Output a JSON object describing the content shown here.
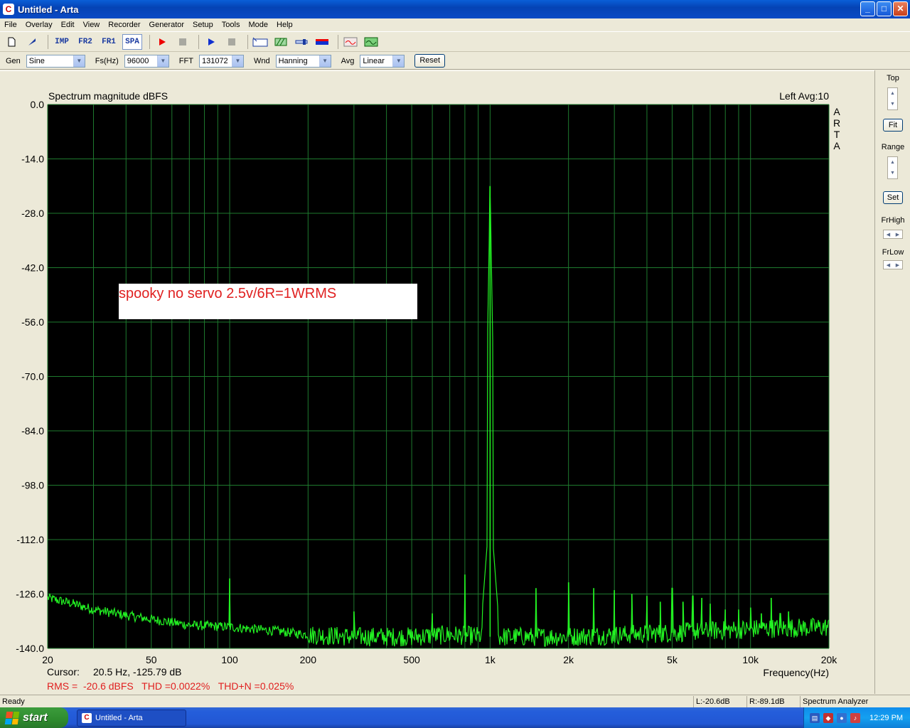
{
  "window": {
    "title": "Untitled - Arta",
    "app_icon": "arta-c-logo",
    "minimize_glyph": "_",
    "maximize_glyph": "□",
    "close_glyph": "✕"
  },
  "menu": [
    "File",
    "Overlay",
    "Edit",
    "View",
    "Recorder",
    "Generator",
    "Setup",
    "Tools",
    "Mode",
    "Help"
  ],
  "toolbar": {
    "imp_label": "IMP",
    "fr2_label": "FR2",
    "fr1_label": "FR1",
    "spa_label": "SPA",
    "icons": [
      "new-file-icon",
      "open-icon",
      "record-icon",
      "stop-icon",
      "play-icon",
      "stop-icon",
      "text-abc-icon",
      "grid-icon",
      "cursor-icon",
      "color-icon",
      "signal-icon",
      "scope-icon"
    ]
  },
  "controls": {
    "gen_label": "Gen",
    "gen_value": "Sine",
    "fs_label": "Fs(Hz)",
    "fs_value": "96000",
    "fft_label": "FFT",
    "fft_value": "131072",
    "wnd_label": "Wnd",
    "wnd_value": "Hanning",
    "avg_label": "Avg",
    "avg_value": "Linear",
    "reset_label": "Reset"
  },
  "sidebar": {
    "top_label": "Top",
    "fit_label": "Fit",
    "range_label": "Range",
    "set_label": "Set",
    "frhigh_label": "FrHigh",
    "frlow_label": "FrLow"
  },
  "chart_data": {
    "type": "line",
    "title": "Spectrum magnitude dBFS",
    "channel_info": "Left   Avg:10",
    "brand_vertical": "ARTA",
    "xlabel": "Frequency(Hz)",
    "xscale": "log",
    "xlim": [
      20,
      20000
    ],
    "ylim": [
      -140,
      0
    ],
    "x_ticks": [
      {
        "v": 20,
        "label": "20"
      },
      {
        "v": 50,
        "label": "50"
      },
      {
        "v": 100,
        "label": "100"
      },
      {
        "v": 200,
        "label": "200"
      },
      {
        "v": 500,
        "label": "500"
      },
      {
        "v": 1000,
        "label": "1k"
      },
      {
        "v": 2000,
        "label": "2k"
      },
      {
        "v": 5000,
        "label": "5k"
      },
      {
        "v": 10000,
        "label": "10k"
      },
      {
        "v": 20000,
        "label": "20k"
      }
    ],
    "y_ticks": [
      {
        "v": 0,
        "label": "0.0"
      },
      {
        "v": -14,
        "label": "-14.0"
      },
      {
        "v": -28,
        "label": "-28.0"
      },
      {
        "v": -42,
        "label": "-42.0"
      },
      {
        "v": -56,
        "label": "-56.0"
      },
      {
        "v": -70,
        "label": "-70.0"
      },
      {
        "v": -84,
        "label": "-84.0"
      },
      {
        "v": -98,
        "label": "-98.0"
      },
      {
        "v": -112,
        "label": "-112.0"
      },
      {
        "v": -126,
        "label": "-126.0"
      },
      {
        "v": -140,
        "label": "-140.0"
      }
    ],
    "grid": true,
    "background": "#000000",
    "grid_color": "#1e7a2e",
    "trace_color": "#22f022",
    "noise_floor": [
      [
        20,
        -127
      ],
      [
        25,
        -128.5
      ],
      [
        30,
        -130
      ],
      [
        40,
        -131.5
      ],
      [
        50,
        -132.5
      ],
      [
        70,
        -134
      ],
      [
        100,
        -134.5
      ],
      [
        150,
        -135.5
      ],
      [
        200,
        -136.5
      ],
      [
        300,
        -137
      ],
      [
        500,
        -137
      ],
      [
        700,
        -136.5
      ],
      [
        1000,
        -137
      ],
      [
        2000,
        -137
      ],
      [
        5000,
        -136
      ],
      [
        10000,
        -135
      ],
      [
        20000,
        -134.5
      ]
    ],
    "peaks": [
      {
        "f": 100,
        "db": -122
      },
      {
        "f": 300,
        "db": -130.5
      },
      {
        "f": 600,
        "db": -131
      },
      {
        "f": 800,
        "db": -121
      },
      {
        "f": 1000,
        "db": -21
      },
      {
        "f": 1500,
        "db": -124.5
      },
      {
        "f": 2000,
        "db": -123
      },
      {
        "f": 2500,
        "db": -124.5
      },
      {
        "f": 3000,
        "db": -125
      },
      {
        "f": 3500,
        "db": -126
      },
      {
        "f": 4000,
        "db": -126.5
      },
      {
        "f": 4500,
        "db": -128
      },
      {
        "f": 5000,
        "db": -124.5
      },
      {
        "f": 5500,
        "db": -128
      },
      {
        "f": 6000,
        "db": -126.5
      },
      {
        "f": 6500,
        "db": -127
      },
      {
        "f": 7000,
        "db": -128.5
      },
      {
        "f": 8000,
        "db": -130
      },
      {
        "f": 9000,
        "db": -130
      },
      {
        "f": 10000,
        "db": -129.5
      },
      {
        "f": 11000,
        "db": -131
      },
      {
        "f": 12000,
        "db": -127
      },
      {
        "f": 13000,
        "db": -131
      },
      {
        "f": 14000,
        "db": -130.5
      }
    ],
    "annotation": "spooky no servo 2.5v/6R=1WRMS",
    "cursor_label": "Cursor:",
    "cursor_value": "20.5 Hz, -125.79 dB",
    "measurements": "RMS =  -20.6 dBFS   THD =0.0022%   THD+N =0.025%"
  },
  "status": {
    "ready": "Ready",
    "left_level": "L:-20.6dB",
    "right_level": "R:-89.1dB",
    "mode": "Spectrum Analyzer"
  },
  "taskbar": {
    "start_label": "start",
    "task_label": "Untitled - Arta",
    "clock": "12:29 PM"
  }
}
